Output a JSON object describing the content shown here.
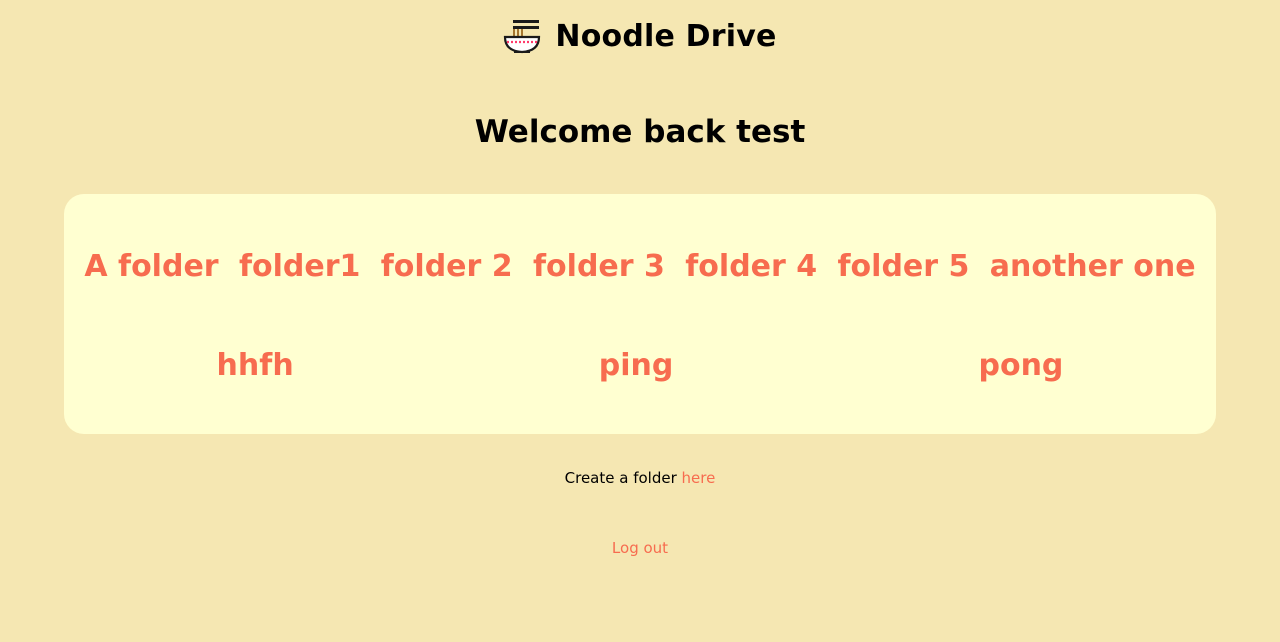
{
  "app": {
    "title": "Noodle Drive",
    "logo_icon": "noodle-bowl-icon"
  },
  "welcome": {
    "text": "Welcome back test"
  },
  "folders": {
    "row1": [
      "A folder",
      "folder1",
      "folder 2",
      "folder 3",
      "folder 4",
      "folder 5",
      "another one"
    ],
    "row2": [
      "hhfh",
      "ping",
      "pong"
    ]
  },
  "create": {
    "prefix": "Create a folder ",
    "link": "here"
  },
  "logout": {
    "label": "Log out"
  },
  "colors": {
    "background": "#f5e7b2",
    "panel": "#ffffd1",
    "accent": "#f76c4f",
    "text": "#000000"
  }
}
